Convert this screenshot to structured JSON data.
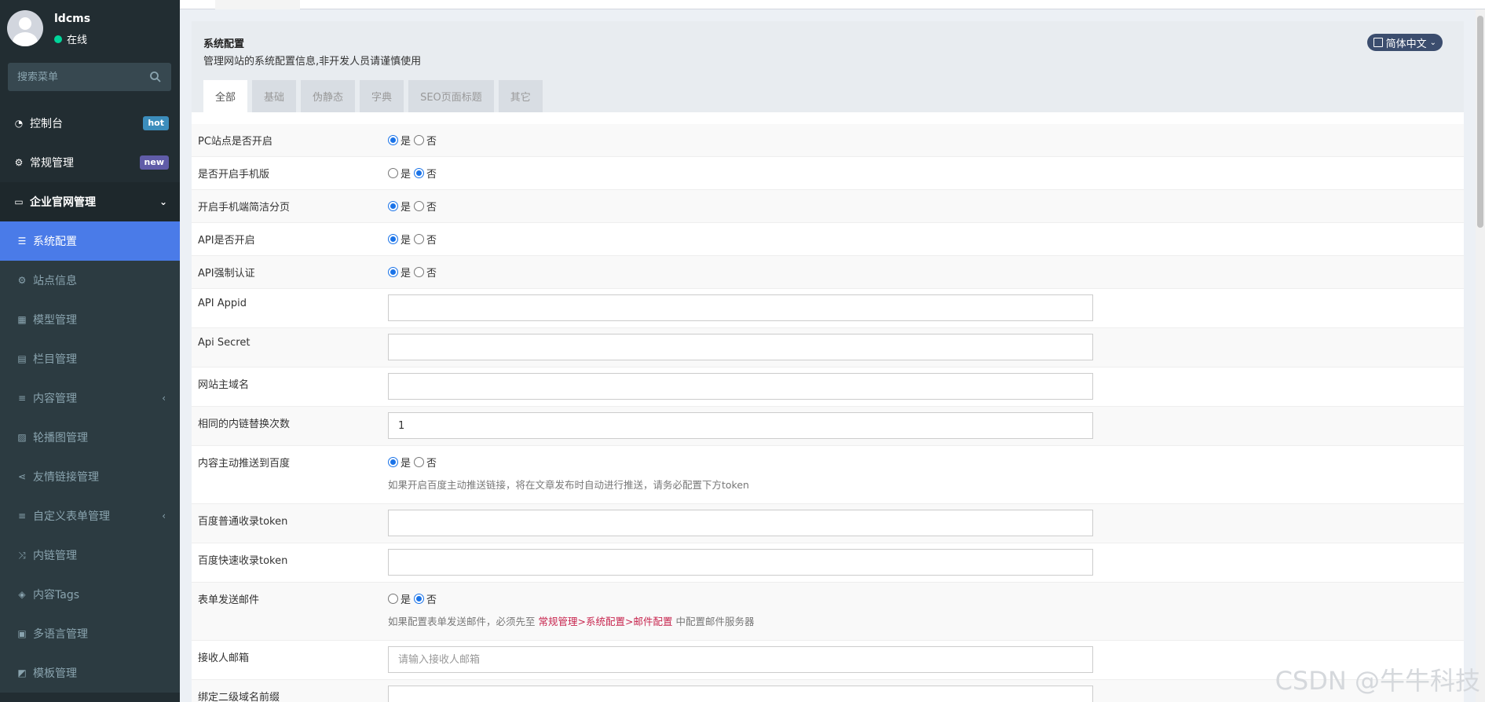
{
  "user": {
    "name": "ldcms",
    "status": "在线"
  },
  "search": {
    "placeholder": "搜索菜单"
  },
  "menu": {
    "dashboard": {
      "label": "控制台",
      "badge": "hot"
    },
    "general": {
      "label": "常规管理",
      "badge": "new"
    },
    "enterprise": {
      "label": "企业官网管理"
    },
    "sub": [
      {
        "label": "系统配置"
      },
      {
        "label": "站点信息"
      },
      {
        "label": "模型管理"
      },
      {
        "label": "栏目管理"
      },
      {
        "label": "内容管理"
      },
      {
        "label": "轮播图管理"
      },
      {
        "label": "友情链接管理"
      },
      {
        "label": "自定义表单管理"
      },
      {
        "label": "内链管理"
      },
      {
        "label": "内容Tags"
      },
      {
        "label": "多语言管理"
      },
      {
        "label": "模板管理"
      }
    ]
  },
  "panel": {
    "title": "系统配置",
    "subtitle": "管理网站的系统配置信息,非开发人员请谨慎使用",
    "lang": "简体中文"
  },
  "tabs": [
    "全部",
    "基础",
    "伪静态",
    "字典",
    "SEO页面标题",
    "其它"
  ],
  "radio": {
    "yes": "是",
    "no": "否"
  },
  "form": {
    "pc_open": "PC站点是否开启",
    "mobile_open": "是否开启手机版",
    "mobile_simple_page": "开启手机端简洁分页",
    "api_open": "API是否开启",
    "api_auth": "API强制认证",
    "api_appid": "API Appid",
    "api_secret": "Api Secret",
    "domain": "网站主域名",
    "link_replace_times": "相同的内链替换次数",
    "link_replace_value": "1",
    "baidu_push": "内容主动推送到百度",
    "baidu_push_help": "如果开启百度主动推送链接，将在文章发布时自动进行推送，请务必配置下方token",
    "baidu_token": "百度普通收录token",
    "baidu_fast_token": "百度快速收录token",
    "form_mail": "表单发送邮件",
    "form_mail_help_pre": "如果配置表单发送邮件，必须先至",
    "form_mail_help_link": "常规管理>系统配置>邮件配置",
    "form_mail_help_post": "中配置邮件服务器",
    "receiver_email": "接收人邮箱",
    "receiver_email_placeholder": "请输入接收人邮箱",
    "subdomain_prefix": "绑定二级域名前缀"
  },
  "watermark": "CSDN @牛牛科技"
}
